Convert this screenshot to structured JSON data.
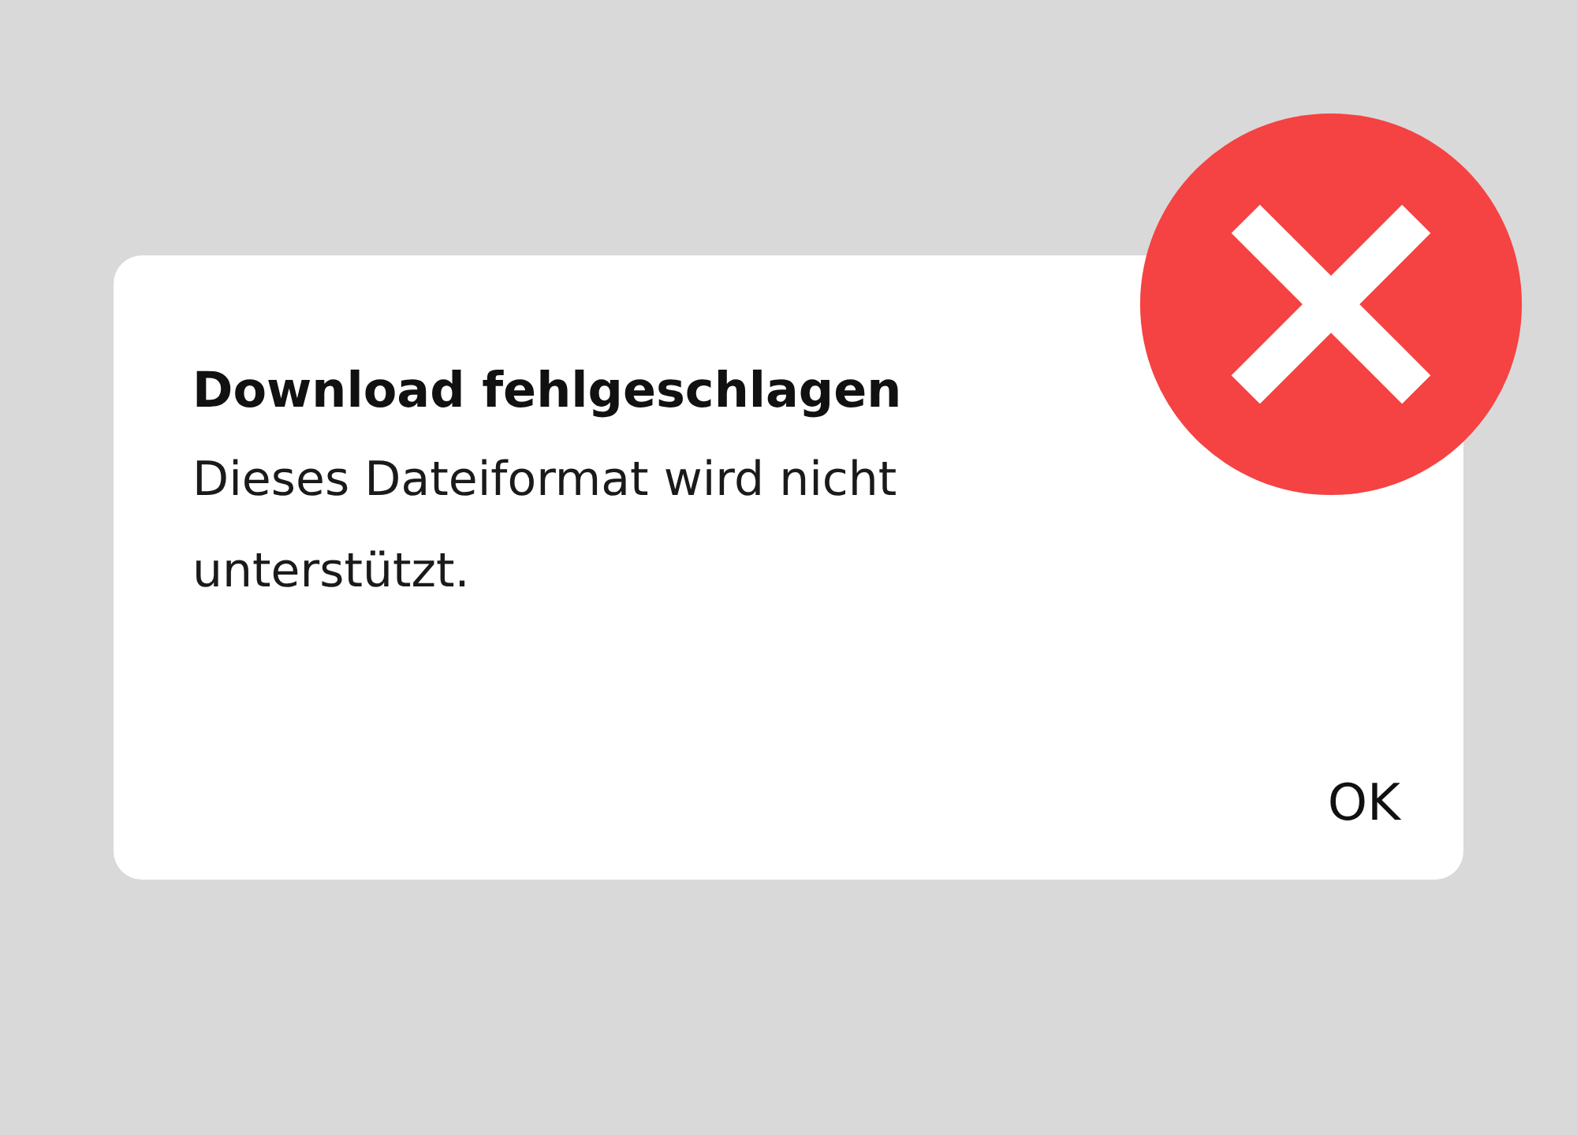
{
  "dialog": {
    "title": "Download fehlgeschlagen",
    "message": "Dieses Dateiformat wird nicht unterstützt.",
    "buttons": [
      "OK"
    ]
  }
}
